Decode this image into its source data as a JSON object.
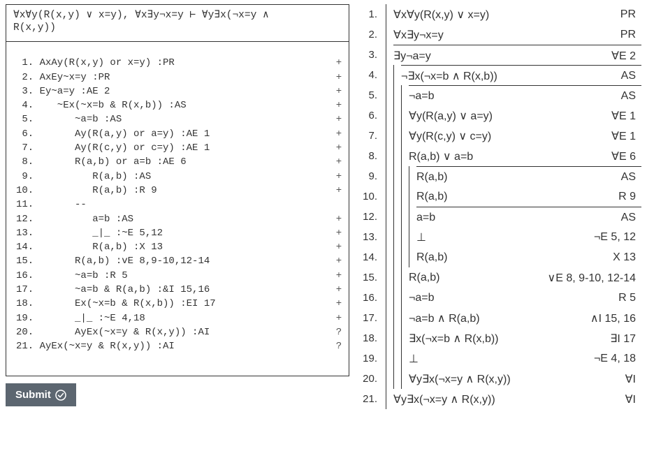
{
  "problem_statement": "∀x∀y(R(x,y) ∨ x=y), ∀x∃y¬x=y ⊢ ∀y∃x(¬x=y ∧\nR(x,y))",
  "editor": {
    "lines": [
      " 1. AxAy(R(x,y) or x=y) :PR",
      " 2. AxEy~x=y :PR",
      " 3. Ey~a=y :AE 2",
      " 4.    ~Ex(~x=b & R(x,b)) :AS",
      " 5.       ~a=b :AS",
      " 6.       Ay(R(a,y) or a=y) :AE 1",
      " 7.       Ay(R(c,y) or c=y) :AE 1",
      " 8.       R(a,b) or a=b :AE 6",
      " 9.          R(a,b) :AS",
      "10.          R(a,b) :R 9",
      "11.       --",
      "12.          a=b :AS",
      "13.          _|_ :~E 5,12",
      "14.          R(a,b) :X 13",
      "15.       R(a,b) :vE 8,9-10,12-14",
      "16.       ~a=b :R 5",
      "17.       ~a=b & R(a,b) :&I 15,16",
      "18.       Ex(~x=b & R(x,b)) :EI 17",
      "19.       _|_ :~E 4,18",
      "20.       AyEx(~x=y & R(x,y)) :AI",
      "21. AyEx(~x=y & R(x,y)) :AI"
    ],
    "gutter_marks": [
      "+",
      "+",
      "+",
      "+",
      "+",
      "+",
      "+",
      "+",
      "+",
      "+",
      "",
      "+",
      "+",
      "+",
      "+",
      "+",
      "+",
      "+",
      "+",
      "?",
      "?"
    ]
  },
  "submit_label": "Submit",
  "proof": [
    {
      "n": "1.",
      "depth": 1,
      "new_sub": false,
      "formula": "∀x∀y(R(x,y) ∨ x=y)",
      "just": "PR"
    },
    {
      "n": "2.",
      "depth": 1,
      "new_sub": false,
      "formula": "∀x∃y¬x=y",
      "just": "PR"
    },
    {
      "n": "3.",
      "depth": 1,
      "new_sub": true,
      "formula": "∃y¬a=y",
      "just": "∀E 2"
    },
    {
      "n": "4.",
      "depth": 2,
      "new_sub": true,
      "formula": "¬∃x(¬x=b ∧ R(x,b))",
      "just": "AS"
    },
    {
      "n": "5.",
      "depth": 3,
      "new_sub": true,
      "formula": "¬a=b",
      "just": "AS"
    },
    {
      "n": "6.",
      "depth": 3,
      "new_sub": false,
      "formula": "∀y(R(a,y) ∨ a=y)",
      "just": "∀E 1"
    },
    {
      "n": "7.",
      "depth": 3,
      "new_sub": false,
      "formula": "∀y(R(c,y) ∨ c=y)",
      "just": "∀E 1"
    },
    {
      "n": "8.",
      "depth": 3,
      "new_sub": false,
      "formula": "R(a,b) ∨ a=b",
      "just": "∀E 6"
    },
    {
      "n": "9.",
      "depth": 4,
      "new_sub": true,
      "formula": "R(a,b)",
      "just": "AS"
    },
    {
      "n": "10.",
      "depth": 4,
      "new_sub": false,
      "formula": "R(a,b)",
      "just": "R 9"
    },
    {
      "n": "12.",
      "depth": 4,
      "new_sub": true,
      "formula": "a=b",
      "just": "AS"
    },
    {
      "n": "13.",
      "depth": 4,
      "new_sub": false,
      "formula": "⊥",
      "just": "¬E 5, 12"
    },
    {
      "n": "14.",
      "depth": 4,
      "new_sub": false,
      "formula": "R(a,b)",
      "just": "X 13"
    },
    {
      "n": "15.",
      "depth": 3,
      "new_sub": false,
      "formula": "R(a,b)",
      "just": "∨E 8, 9-10, 12-14"
    },
    {
      "n": "16.",
      "depth": 3,
      "new_sub": false,
      "formula": "¬a=b",
      "just": "R 5"
    },
    {
      "n": "17.",
      "depth": 3,
      "new_sub": false,
      "formula": "¬a=b ∧ R(a,b)",
      "just": "∧I 15, 16"
    },
    {
      "n": "18.",
      "depth": 3,
      "new_sub": false,
      "formula": "∃x(¬x=b ∧ R(x,b))",
      "just": "∃I 17"
    },
    {
      "n": "19.",
      "depth": 3,
      "new_sub": false,
      "formula": "⊥",
      "just": "¬E 4, 18"
    },
    {
      "n": "20.",
      "depth": 3,
      "new_sub": false,
      "formula": "∀y∃x(¬x=y ∧ R(x,y))",
      "just": "∀I"
    },
    {
      "n": "21.",
      "depth": 1,
      "new_sub": false,
      "formula": "∀y∃x(¬x=y ∧ R(x,y))",
      "just": "∀I"
    }
  ]
}
